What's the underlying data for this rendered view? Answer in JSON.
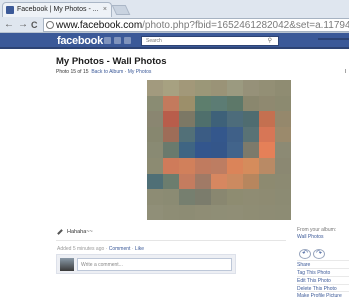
{
  "browser": {
    "tab_title": "Facebook | My Photos - ...",
    "tab_close": "×",
    "nav_back": "←",
    "nav_forward": "→",
    "nav_reload": "C",
    "url_host": "www.facebook.com",
    "url_rest": "/photo.php?fbid=1652461282042&set=a.1179485817951.2028071.1552327!"
  },
  "header": {
    "logo": "facebook",
    "search_placeholder": "Search",
    "search_icon": "magnifier-icon"
  },
  "album": {
    "title": "My Photos - Wall Photos",
    "position": "Photo 15 of 15",
    "back_link": "Back to Album",
    "sep": "·",
    "photos_link": "My Photos",
    "right_letter": "l"
  },
  "photo": {
    "palette": [
      [
        "#a29a7e",
        "#a7a181",
        "#a29879",
        "#9b9778",
        "#9a9377",
        "#9b9a80",
        "#969179",
        "#938f75",
        "#8f8c72"
      ],
      [
        "#8a8c73",
        "#c37a5d",
        "#9c8f6a",
        "#5d7e6d",
        "#5c7c74",
        "#5d7869",
        "#8a876e",
        "#8f8970",
        "#8c8a70"
      ],
      [
        "#8a8671",
        "#b85d4b",
        "#7c7865",
        "#4f6f6c",
        "#3e6179",
        "#4d6c7b",
        "#4f6c70",
        "#c47050",
        "#95886c"
      ],
      [
        "#87876f",
        "#9e6d58",
        "#527078",
        "#3b5c84",
        "#34578c",
        "#3f6088",
        "#597275",
        "#d77656",
        "#9b8a6c"
      ],
      [
        "#898a73",
        "#6a7a6d",
        "#3f6583",
        "#33568d",
        "#34568a",
        "#42648b",
        "#7c7a6b",
        "#e58058",
        "#8c8a74"
      ],
      [
        "#8c8b72",
        "#cf7b5a",
        "#d1805b",
        "#c07b5f",
        "#bd7d62",
        "#db8459",
        "#d58c5c",
        "#b98a65",
        "#8b8872"
      ],
      [
        "#4f6f76",
        "#6c7d6e",
        "#c47c5f",
        "#a07a66",
        "#d78760",
        "#cc8a60",
        "#b7865e",
        "#8d8a70",
        "#8c8a72"
      ],
      [
        "#8d8c74",
        "#8b8b73",
        "#767f6f",
        "#7b7c6c",
        "#898770",
        "#8e8c71",
        "#8f8c73",
        "#8e8b72",
        "#8c8b73"
      ],
      [
        "#908f78",
        "#8e8d75",
        "#8d8c74",
        "#8f8d75",
        "#8f8e76",
        "#908e76",
        "#8f8d74",
        "#8e8c74",
        "#8d8c74"
      ]
    ]
  },
  "caption": {
    "text": "Hahaha~~"
  },
  "meta": {
    "time": "Added 5 minutes ago",
    "sep1": "·",
    "comment_link": "Comment",
    "sep2": "·",
    "like_link": "Like"
  },
  "comment": {
    "placeholder": "Write a comment..."
  },
  "sidebar": {
    "from_label": "From your album:",
    "album_link": "Wall Photos",
    "rotate_left": "↶",
    "rotate_right": "↷",
    "actions": [
      "Share",
      "Tag This Photo",
      "Edit This Photo",
      "Delete This Photo",
      "Make Profile Picture"
    ]
  },
  "colors": {
    "brand": "#3b5998",
    "link": "#3b5998"
  }
}
